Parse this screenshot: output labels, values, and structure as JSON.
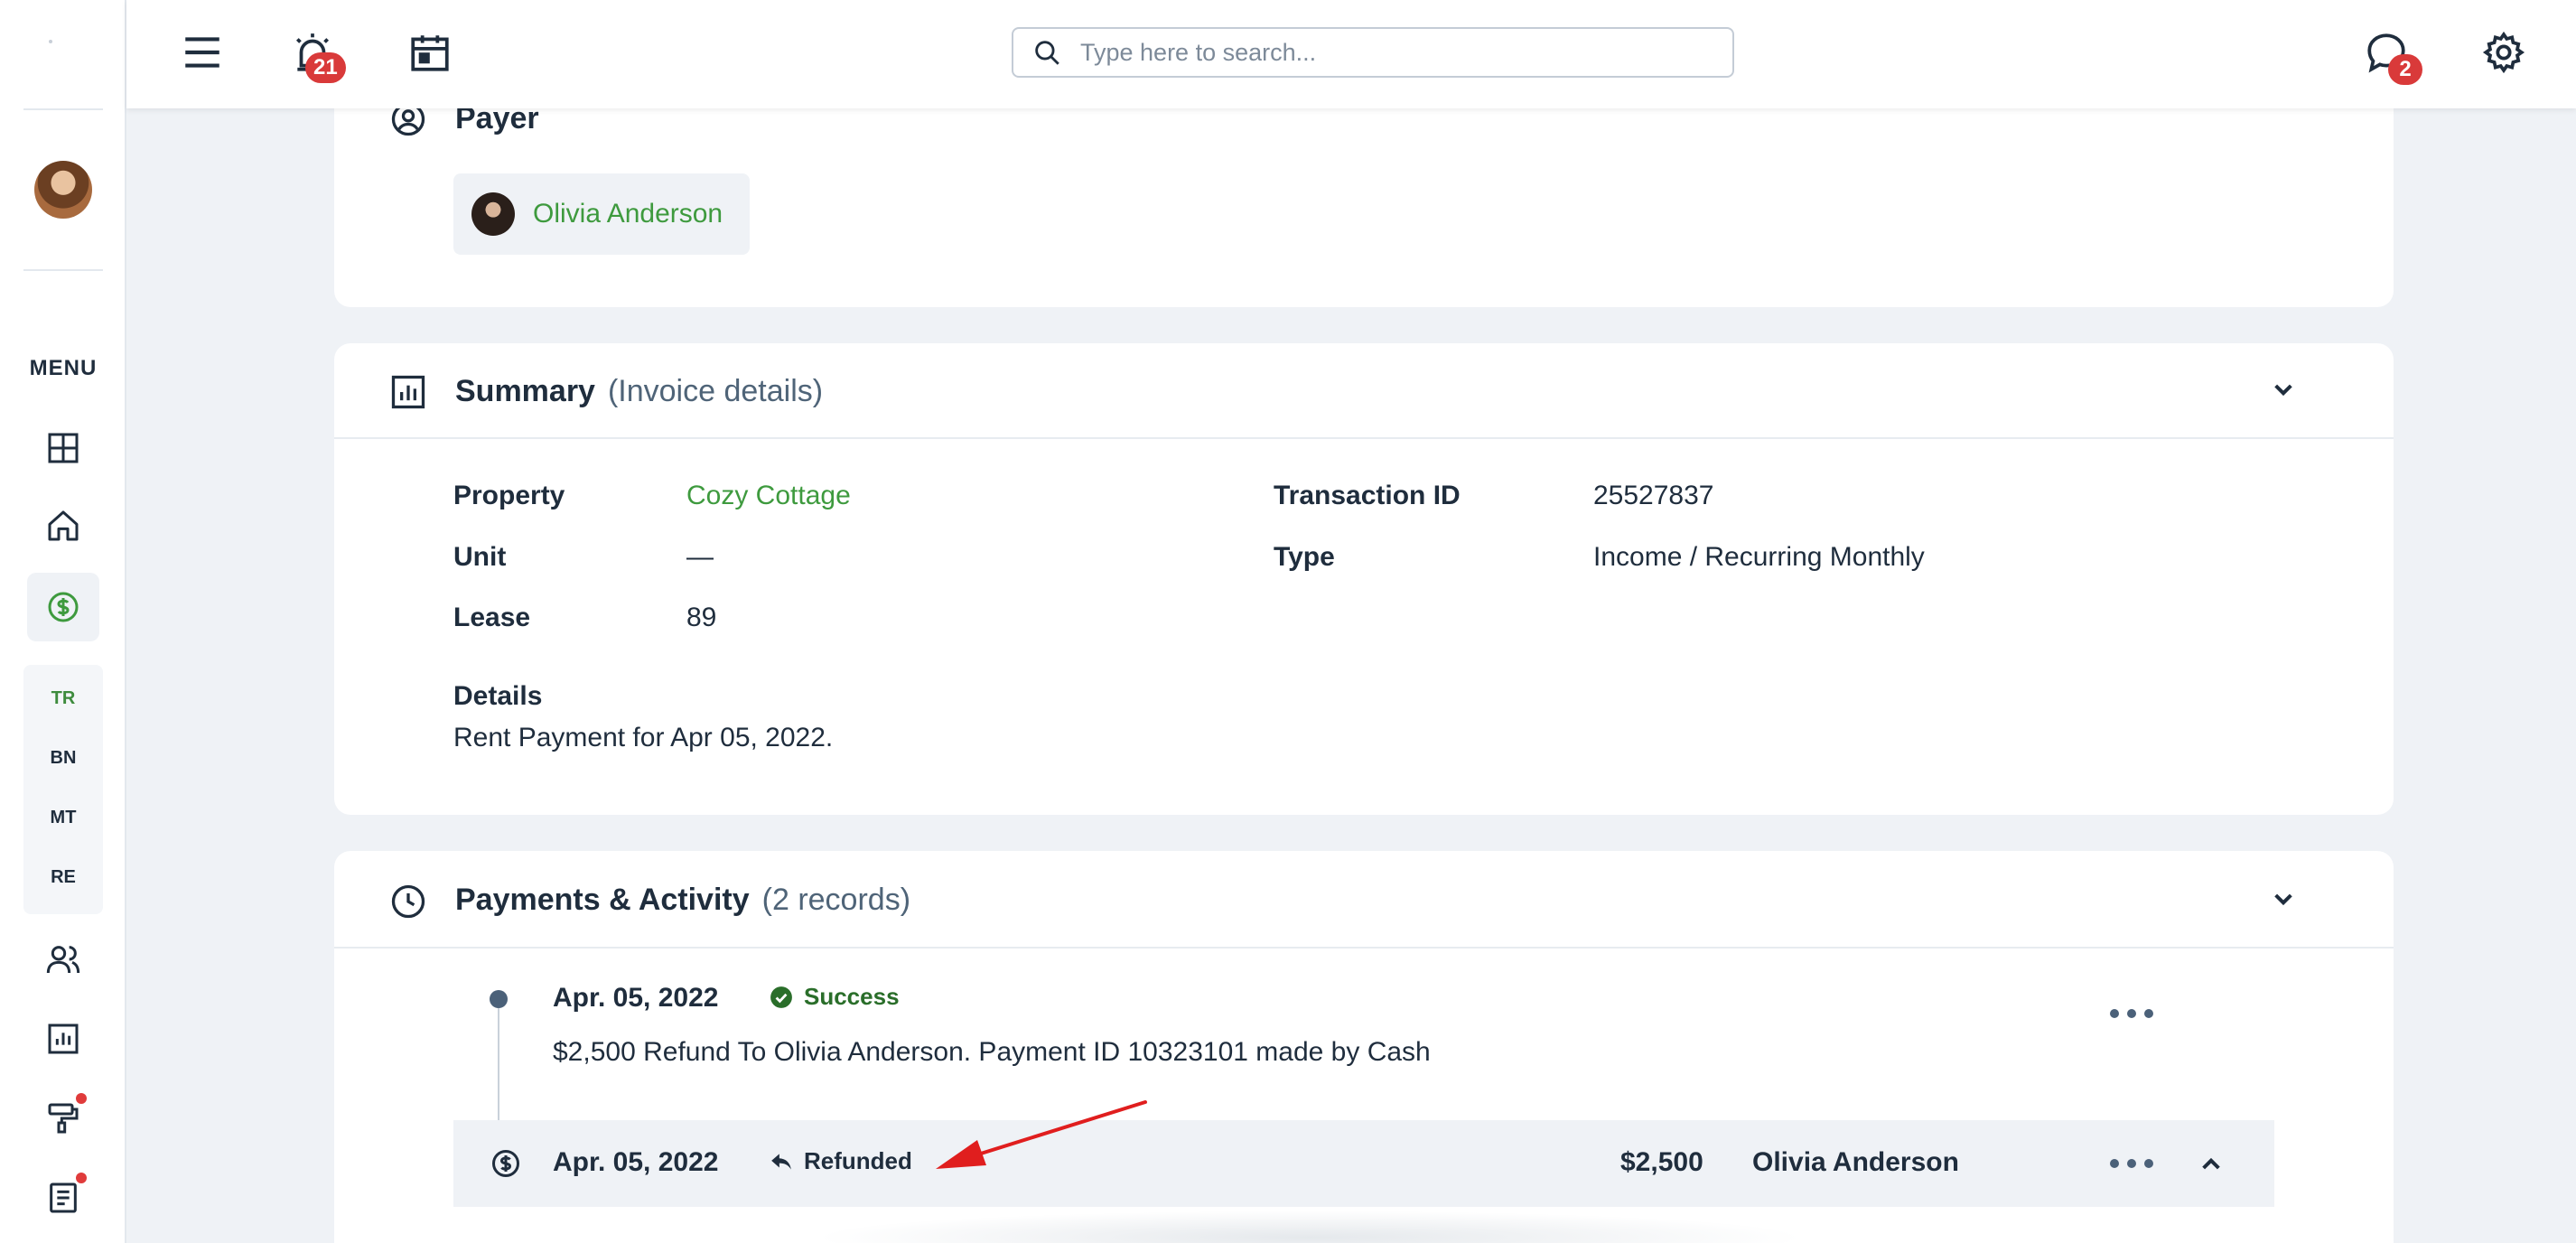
{
  "topbar": {
    "alarm_badge": "21",
    "chat_badge": "2",
    "search_placeholder": "Type here to search..."
  },
  "sidebar": {
    "menu_label": "MENU",
    "sub_items": [
      "TR",
      "BN",
      "MT",
      "RE"
    ]
  },
  "payer": {
    "title": "Payer",
    "name": "Olivia Anderson"
  },
  "summary": {
    "title": "Summary",
    "subtitle": "(Invoice details)",
    "property_label": "Property",
    "property_value": "Cozy Cottage",
    "unit_label": "Unit",
    "unit_value": "—",
    "lease_label": "Lease",
    "lease_value": "89",
    "transaction_label": "Transaction ID",
    "transaction_value": "25527837",
    "type_label": "Type",
    "type_value": "Income / Recurring Monthly",
    "details_label": "Details",
    "details_value": "Rent Payment for Apr 05, 2022."
  },
  "activity": {
    "title": "Payments & Activity",
    "subtitle": "(2 records)",
    "entry": {
      "date": "Apr. 05, 2022",
      "status": "Success",
      "description": "$2,500 Refund To Olivia Anderson. Payment ID 10323101 made by Cash"
    },
    "refund": {
      "date": "Apr. 05, 2022",
      "status": "Refunded",
      "amount": "$2,500",
      "name": "Olivia Anderson"
    }
  },
  "colors": {
    "accent_green": "#3e9a3e",
    "badge_red": "#d93a3a",
    "annotation_red": "#e01e1e"
  }
}
